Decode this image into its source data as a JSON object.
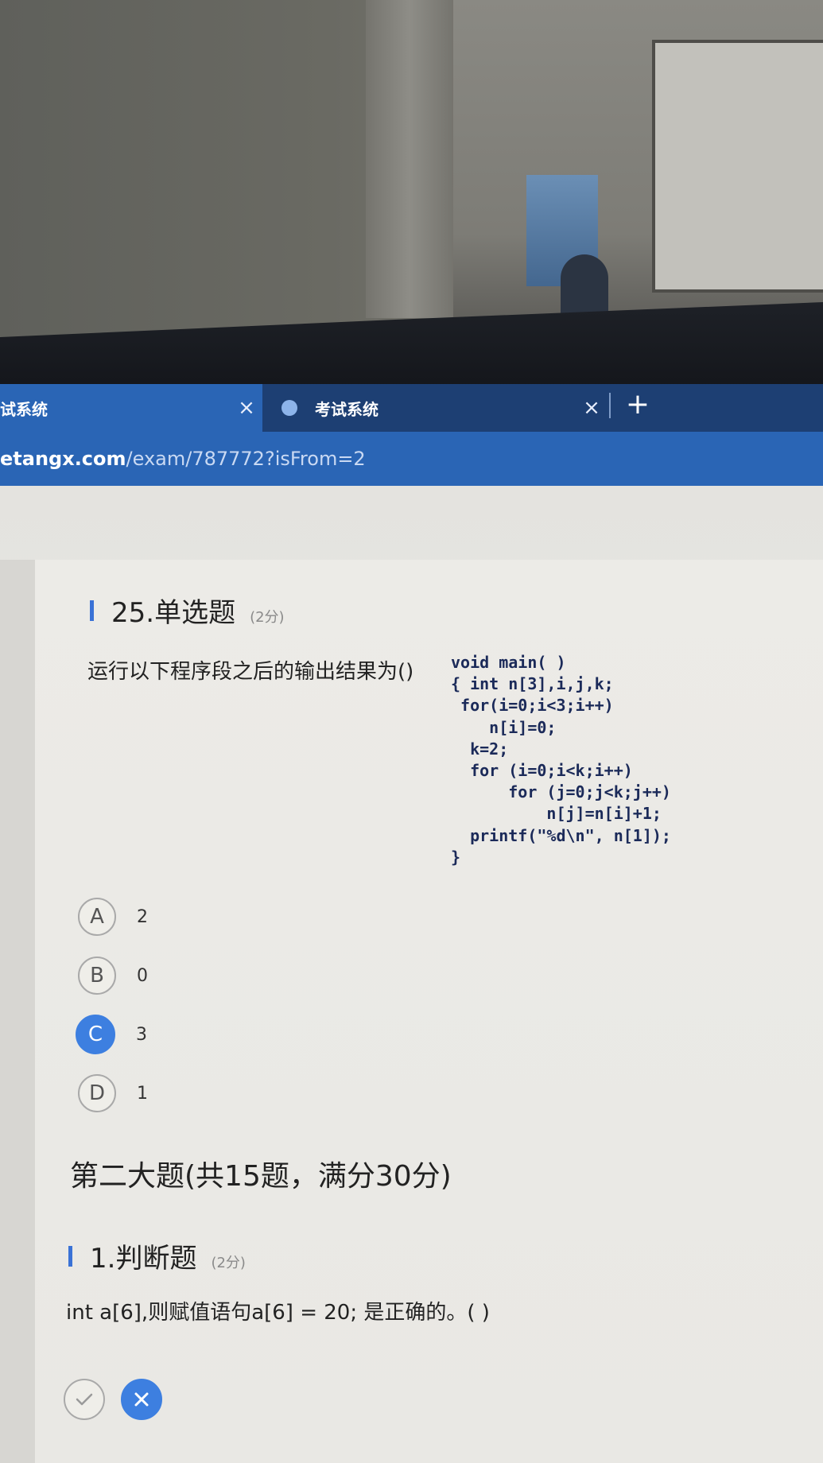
{
  "browser": {
    "tabs": [
      {
        "label": "试系统",
        "active": true
      },
      {
        "label": "考试系统",
        "active": false
      }
    ],
    "close_glyph": "×",
    "new_tab_glyph": "+",
    "address": {
      "host": "etangx.com",
      "path": "/exam/787772?isFrom=2"
    }
  },
  "question25": {
    "number_title": "25.单选题",
    "points": "(2分)",
    "stem": "运行以下程序段之后的输出结果为()",
    "code": "void main( )\n{ int n[3],i,j,k;\n for(i=0;i<3;i++)\n    n[i]=0;\n  k=2;\n  for (i=0;i<k;i++)\n      for (j=0;j<k;j++)\n          n[j]=n[i]+1;\n  printf(\"%d\\n\", n[1]);\n}",
    "options": [
      {
        "letter": "A",
        "text": "2"
      },
      {
        "letter": "B",
        "text": "0"
      },
      {
        "letter": "C",
        "text": "3",
        "selected": true
      },
      {
        "letter": "D",
        "text": "1"
      }
    ]
  },
  "section2": {
    "title": "第二大题(共15题，满分30分)"
  },
  "question1": {
    "number_title": "1.判断题",
    "points": "(2分)",
    "stem": "int a[6],则赋值语句a[6] = 20; 是正确的。( )",
    "true_icon": "check-icon",
    "false_icon": "close-icon",
    "selected": "false"
  },
  "colors": {
    "accent": "#3d7fe0",
    "tab_bar": "#1d3f73",
    "address_bar": "#2a65b5"
  }
}
